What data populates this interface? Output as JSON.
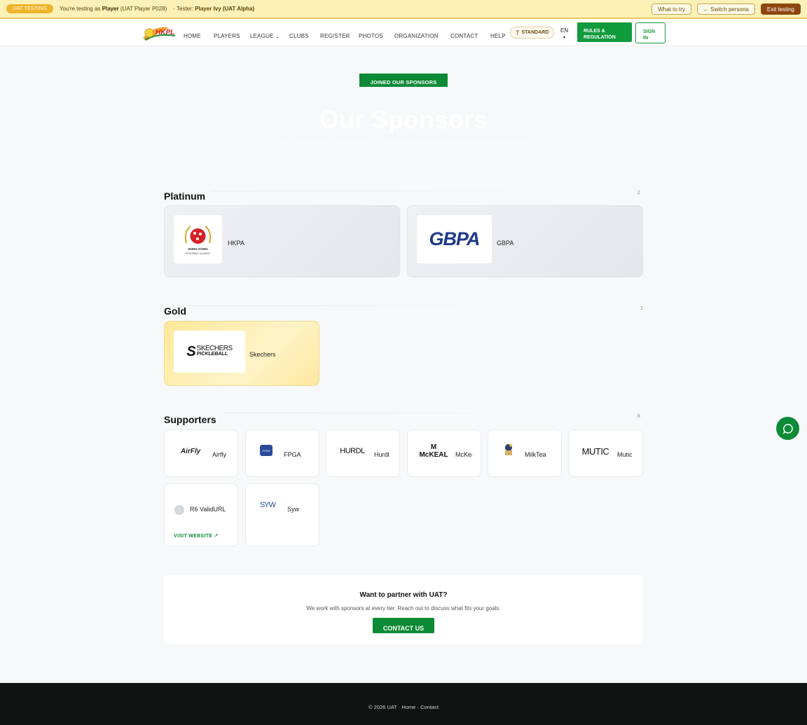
{
  "uat": {
    "pill": "UAT TESTING",
    "prefix": "You're testing as ",
    "role": "Player",
    "player": " (UAT Player P028)",
    "tester_label": "· Tester: ",
    "tester": "Player Ivy (UAT Alpha)",
    "what_to_try": "What to try",
    "switch_persona": "← Switch persona",
    "exit": "Exit testing"
  },
  "nav": {
    "logo_text": "HKPL",
    "items": [
      "HOME",
      "PLAYERS",
      "LEAGUE",
      "CLUBS",
      "REGISTER",
      "PHOTOS",
      "ORGANIZATION",
      "CONTACT",
      "HELP"
    ],
    "league_caret": "⌄",
    "standard": "STANDARD",
    "standard_icon": "T",
    "lang": "EN",
    "lang_caret": "▾",
    "rules_line1": "RULES &",
    "rules_line2": "REGULATION",
    "signin_line1": "SIGN",
    "signin_line2": "IN"
  },
  "hero": {
    "join_button": "JOINED OUR SPONSORS",
    "title": "Our Sponsors",
    "subtitle": "Meet the partners who power UAT — from platinum backers to our community supporters."
  },
  "sections": {
    "platinum": {
      "title": "Platinum",
      "count": "2",
      "items": [
        {
          "name": "HKPA",
          "logo_line1": "HONG KONG",
          "logo_line2": "PICKLEBALL ALLIANCE"
        },
        {
          "name": "GBPA",
          "logo_text": "GBPA"
        }
      ]
    },
    "gold": {
      "title": "Gold",
      "count": "1",
      "items": [
        {
          "name": "Skechers",
          "logo_line1": "SKECHERS",
          "logo_line2": "PICKLEBALL"
        }
      ]
    },
    "supporters": {
      "title": "Supporters",
      "count": "8",
      "items": [
        {
          "name": "Airfly",
          "logo_text": "AirFly"
        },
        {
          "name": "FPGA",
          "logo_text": "FPGA"
        },
        {
          "name": "Hurdl",
          "logo_text": "HURDL"
        },
        {
          "name": "McKeal",
          "logo_text": "McKEAL"
        },
        {
          "name": "MilkTea",
          "logo_text": "MT"
        },
        {
          "name": "Mutic",
          "logo_text": "MUTIC"
        },
        {
          "name": "R6 ValidURL",
          "visit": "VISIT WEBSITE ↗"
        },
        {
          "name": "Syw",
          "logo_text": "SYW"
        }
      ]
    }
  },
  "partner": {
    "title": "Want to partner with UAT?",
    "description": "We work with sponsors at every tier. Reach out to discuss what fits your goals.",
    "button": "CONTACT US"
  },
  "footer": {
    "text": "© 2026 UAT · Home · Contact"
  },
  "colors": {
    "brand_green": "#0c8a35",
    "uat_yellow": "#fdf1b8",
    "exit_brown": "#8e4610"
  }
}
